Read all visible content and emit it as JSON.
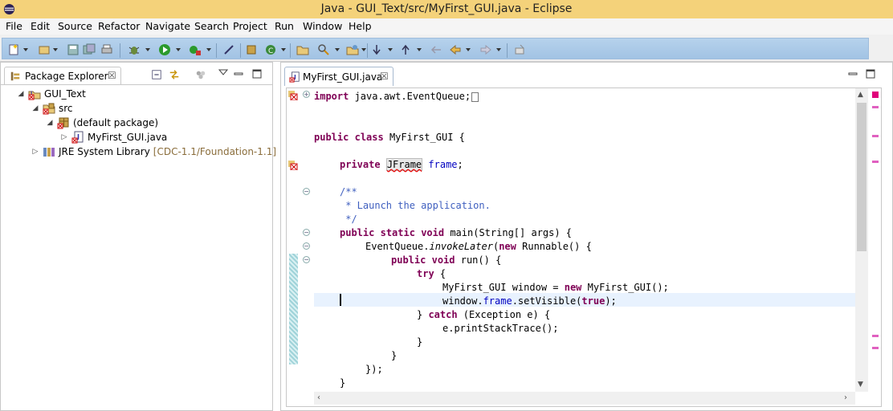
{
  "window": {
    "title": "Java - GUI_Text/src/MyFirst_GUI.java - Eclipse"
  },
  "menu": [
    "File",
    "Edit",
    "Source",
    "Refactor",
    "Navigate",
    "Search",
    "Project",
    "Run",
    "Window",
    "Help"
  ],
  "explorer": {
    "tab_label": "Package Explorer",
    "close_glyph": "☒",
    "tree": {
      "project": "GUI_Text",
      "src": "src",
      "package": "(default package)",
      "file": "MyFirst_GUI.java",
      "library": "JRE System Library",
      "library_suffix": "[CDC-1.1/Foundation-1.1]"
    }
  },
  "editor": {
    "tab_label": "MyFirst_GUI.java",
    "close_glyph": "☒",
    "code": {
      "l1_kw": "import",
      "l1_rest": " java.awt.EventQueue;",
      "l4_kw1": "public",
      "l4_kw2": "class",
      "l4_rest": " MyFirst_GUI {",
      "l6_kw": "private",
      "l6_type": "JFrame",
      "l6_field": "frame",
      "l6_end": ";",
      "l8": "/**",
      "l9": " * Launch the application.",
      "l10": " */",
      "l11_kw1": "public",
      "l11_kw2": "static",
      "l11_kw3": "void",
      "l11_rest": " main(String[] args) {",
      "l12_a": "EventQueue.",
      "l12_b": "invokeLater",
      "l12_c": "(",
      "l12_kw": "new",
      "l12_d": " Runnable() {",
      "l13_kw1": "public",
      "l13_kw2": "void",
      "l13_rest": " run() {",
      "l14_kw": "try",
      "l14_rest": " {",
      "l15_a": "MyFirst_GUI window = ",
      "l15_kw": "new",
      "l15_b": " MyFirst_GUI();",
      "l16_a": "window.",
      "l16_field": "frame",
      "l16_b": ".setVisible(",
      "l16_kw": "true",
      "l16_c": ");",
      "l17_a": "} ",
      "l17_kw": "catch",
      "l17_b": " (Exception e) {",
      "l18": "e.printStackTrace();",
      "l19": "}",
      "l20": "}",
      "l21": "});",
      "l22": "}"
    }
  },
  "colors": {
    "titlebar": "#f4d27a",
    "toolbar_band": "#a2c3e4",
    "keyword": "#7f0055",
    "field": "#0000c0",
    "comment": "#3f5fbf",
    "error": "#e00000"
  }
}
